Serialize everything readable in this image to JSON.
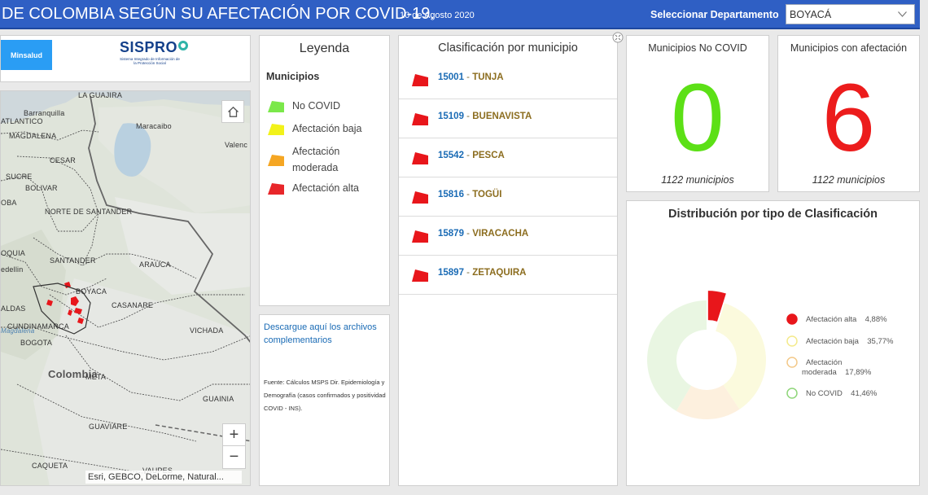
{
  "header": {
    "title": "DE COLOMBIA SEGÚN SU AFECTACIÓN POR COVID-19.",
    "date": "10 de Agosto 2020",
    "select_label": "Seleccionar Departamento",
    "select_value": "BOYACÁ",
    "colors": {
      "bar": "#2f5fc4"
    }
  },
  "logos": {
    "minsalud": "Minsalud",
    "sispro": "SISPRO",
    "sispro_sub": "Sistema Integrado de Información de la Protección Social"
  },
  "map": {
    "labels": {
      "barranquilla": "Barranquilla",
      "atlantico": "ATLANTICO",
      "magdalena": "MAGDALENA",
      "cesar": "CESAR",
      "sucre": "SUCRE",
      "bolivar": "BOLIVAR",
      "oba": "OBA",
      "norte_santander": "NORTE DE SANTANDER",
      "oquia": "OQUIA",
      "santander": "SANTANDER",
      "arauca": "ARAUCA",
      "medellin": "edellin",
      "boyaca": "BOYACA",
      "casanare": "CASANARE",
      "aldas": "ALDAS",
      "cundinamarca": "CUNDINAMARCA",
      "bogota": "BOGOTA",
      "vichada": "VICHADA",
      "colombia": "Colombia",
      "meta": "META",
      "guainia": "GUAINIA",
      "guaviare": "GUAVIARE",
      "caqueta": "CAQUETA",
      "vaupes": "VAUPES",
      "la_guajira": "LA GUAJIRA",
      "maracaibo": "Maracaibo",
      "valencia": "Valenc",
      "magdalena_river": "Magdalena"
    },
    "zoom_in": "+",
    "zoom_out": "−",
    "attribution": "Esri, GEBCO, DeLorme, Natural..."
  },
  "legend": {
    "title": "Leyenda",
    "subtitle": "Municipios",
    "items": [
      {
        "label": "No COVID",
        "color": "#7be84a"
      },
      {
        "label": "Afectación baja",
        "color": "#f2f21a"
      },
      {
        "label": "Afectación moderada",
        "color": "#f5a623"
      },
      {
        "label": "Afectación alta",
        "color": "#e8262a"
      }
    ]
  },
  "download": {
    "link": "Descargue aquí los archivos complementarios",
    "source": "Fuente: Cálculos MSPS Dir. Epidemiología y Demografía (casos confirmados y positividad COVID - INS)."
  },
  "classification": {
    "title": "Clasificación por municipio",
    "flag_color": "#e8161b",
    "rows": [
      {
        "code": "15001",
        "name": "TUNJA"
      },
      {
        "code": "15109",
        "name": "BUENAVISTA"
      },
      {
        "code": "15542",
        "name": "PESCA"
      },
      {
        "code": "15816",
        "name": "TOGÜI"
      },
      {
        "code": "15879",
        "name": "VIRACACHA"
      },
      {
        "code": "15897",
        "name": "ZETAQUIRA"
      }
    ]
  },
  "kpis": {
    "no_covid": {
      "title": "Municipios No COVID",
      "value": "0",
      "sub": "1122 municipios",
      "color": "#5ce016"
    },
    "afectacion": {
      "title": "Municipios con afectación",
      "value": "6",
      "sub": "1122 municipios",
      "color": "#ec1c1c"
    }
  },
  "distribution": {
    "title": "Distribución por tipo de Clasificación",
    "items": [
      {
        "label": "Afectación alta",
        "pct_label": "4,88%",
        "value": 4.88,
        "color": "#e8161b"
      },
      {
        "label": "Afectación baja",
        "pct_label": "35,77%",
        "value": 35.77,
        "color": "#fbfadd"
      },
      {
        "label": "Afectación moderada",
        "pct_label": "17,89%",
        "value": 17.89,
        "color": "#fdf0de"
      },
      {
        "label": "No COVID",
        "pct_label": "41,46%",
        "value": 41.46,
        "color": "#e9f6e2"
      }
    ]
  }
}
